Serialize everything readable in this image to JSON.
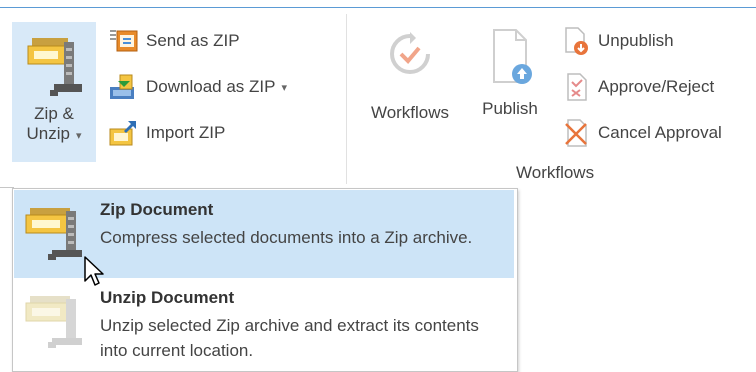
{
  "ribbon": {
    "zip_group": {
      "zip_unzip": {
        "line1": "Zip &",
        "line2": "Unzip",
        "caret": "▾"
      },
      "send_as_zip": "Send as ZIP",
      "download_as_zip": "Download as ZIP",
      "download_caret": "▾",
      "import_zip": "Import ZIP"
    },
    "workflows_group": {
      "workflows": "Workflows",
      "publish": "Publish",
      "unpublish": "Unpublish",
      "approve_reject": "Approve/Reject",
      "cancel_approval": "Cancel Approval",
      "group_label": "Workflows"
    }
  },
  "menu": {
    "items": [
      {
        "title": "Zip Document",
        "description": "Compress selected documents into a Zip archive.",
        "state": "hover"
      },
      {
        "title": "Unzip Document",
        "description": "Unzip selected Zip archive and extract its contents into current location.",
        "state": "disabled"
      }
    ]
  },
  "colors": {
    "accent": "#5b9bd5",
    "hover": "#cde4f7",
    "disabled_icon": "#cfcfcf"
  },
  "icons": [
    "clamp-zip-icon",
    "send-zip-icon",
    "download-zip-icon",
    "import-zip-icon",
    "workflows-icon",
    "publish-icon",
    "unpublish-icon",
    "approve-reject-icon",
    "cancel-approval-icon",
    "mouse-cursor-icon"
  ]
}
